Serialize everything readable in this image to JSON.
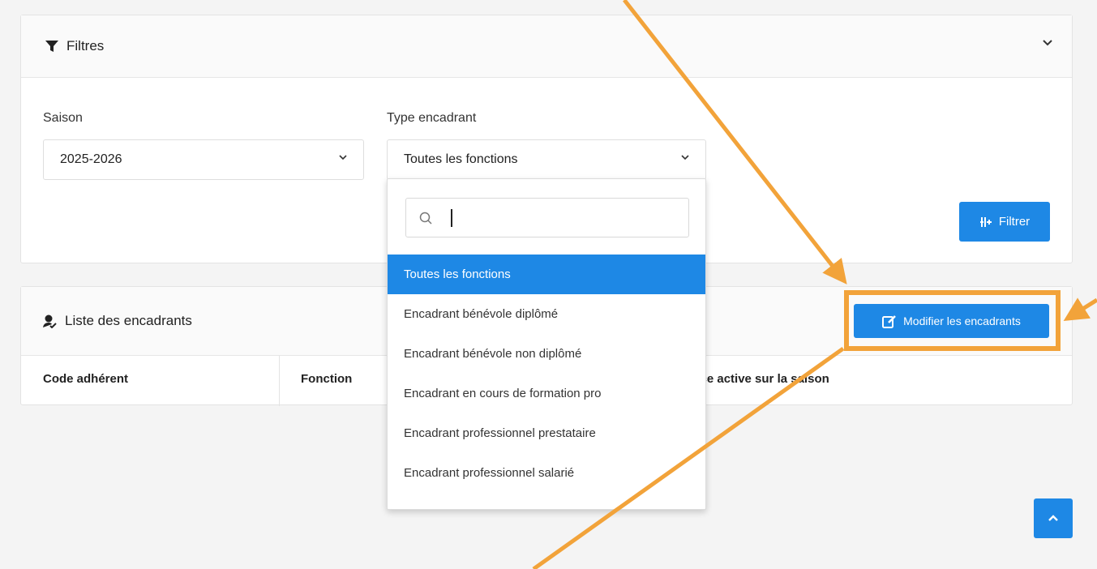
{
  "filters": {
    "title": "Filtres",
    "season_label": "Saison",
    "season_value": "2025-2026",
    "type_label": "Type encadrant",
    "type_value": "Toutes les fonctions",
    "filter_button": "Filtrer"
  },
  "dropdown": {
    "search_value": "",
    "options": [
      "Toutes les fonctions",
      "Encadrant bénévole diplômé",
      "Encadrant bénévole non diplômé",
      "Encadrant en cours de formation pro",
      "Encadrant professionnel prestataire",
      "Encadrant professionnel salarié"
    ],
    "selected_index": 0
  },
  "list": {
    "title": "Liste des encadrants",
    "edit_button": "Modifier les encadrants",
    "columns": [
      "Code adhérent",
      "Fonction",
      "ence active sur la saison"
    ]
  },
  "colors": {
    "accent": "#1e88e5",
    "annotation": "#f2a33a"
  }
}
